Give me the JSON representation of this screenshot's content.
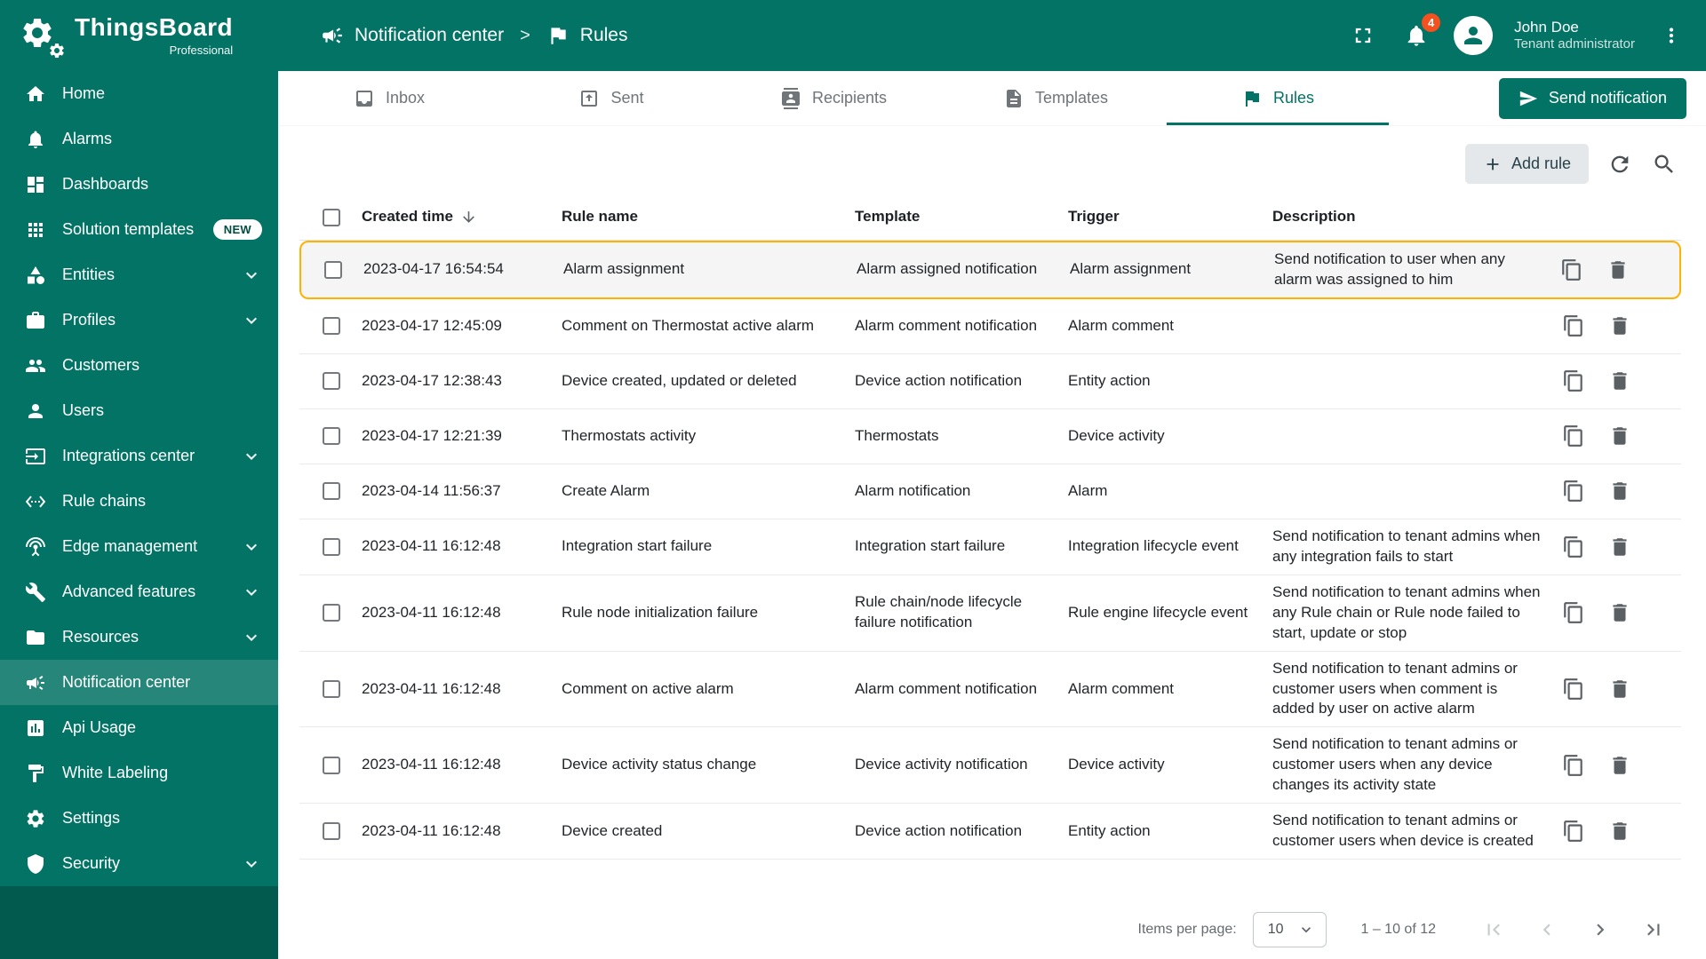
{
  "colors": {
    "primary": "#037365",
    "sidebar_bottom": "#025a4e",
    "highlight_border": "#ffb300",
    "notification_badge_bg": "#f4511e"
  },
  "brand": {
    "name": "ThingsBoard",
    "edition": "Professional"
  },
  "header": {
    "breadcrumb": [
      {
        "label": "Notification center",
        "icon": "campaign"
      },
      {
        "label": "Rules",
        "icon": "flag"
      }
    ],
    "separator": ">",
    "notifications_badge": "4",
    "user": {
      "name": "John Doe",
      "role": "Tenant administrator"
    }
  },
  "sidebar": {
    "items": [
      {
        "label": "Home",
        "icon": "home"
      },
      {
        "label": "Alarms",
        "icon": "bell"
      },
      {
        "label": "Dashboards",
        "icon": "dashboard"
      },
      {
        "label": "Solution templates",
        "icon": "apps",
        "badge": "NEW"
      },
      {
        "label": "Entities",
        "icon": "category",
        "expandable": true
      },
      {
        "label": "Profiles",
        "icon": "briefcase",
        "expandable": true
      },
      {
        "label": "Customers",
        "icon": "people"
      },
      {
        "label": "Users",
        "icon": "person"
      },
      {
        "label": "Integrations center",
        "icon": "input",
        "expandable": true
      },
      {
        "label": "Rule chains",
        "icon": "ethernet"
      },
      {
        "label": "Edge management",
        "icon": "antenna",
        "expandable": true
      },
      {
        "label": "Advanced features",
        "icon": "build",
        "expandable": true
      },
      {
        "label": "Resources",
        "icon": "folder",
        "expandable": true
      },
      {
        "label": "Notification center",
        "icon": "campaign",
        "active": true
      },
      {
        "label": "Api Usage",
        "icon": "chart"
      },
      {
        "label": "White Labeling",
        "icon": "paint"
      },
      {
        "label": "Settings",
        "icon": "gear"
      },
      {
        "label": "Security",
        "icon": "shield",
        "expandable": true
      }
    ]
  },
  "tabs": {
    "items": [
      {
        "label": "Inbox",
        "icon": "inbox"
      },
      {
        "label": "Sent",
        "icon": "outbox"
      },
      {
        "label": "Recipients",
        "icon": "contacts"
      },
      {
        "label": "Templates",
        "icon": "template"
      },
      {
        "label": "Rules",
        "icon": "flag",
        "active": true
      }
    ],
    "send_button": {
      "label": "Send notification",
      "icon": "send"
    }
  },
  "toolbar": {
    "add_rule_label": "Add rule"
  },
  "table": {
    "columns": [
      {
        "label": "Created time",
        "sortable": true,
        "sort": "desc"
      },
      {
        "label": "Rule name"
      },
      {
        "label": "Template"
      },
      {
        "label": "Trigger"
      },
      {
        "label": "Description"
      }
    ],
    "rows": [
      {
        "created": "2023-04-17 16:54:54",
        "name": "Alarm assignment",
        "template": "Alarm assigned notification",
        "trigger": "Alarm assignment",
        "description": "Send notification to user when any alarm was assigned to him",
        "highlighted": true
      },
      {
        "created": "2023-04-17 12:45:09",
        "name": "Comment on Thermostat active alarm",
        "template": "Alarm comment notification",
        "trigger": "Alarm comment",
        "description": ""
      },
      {
        "created": "2023-04-17 12:38:43",
        "name": "Device created, updated or deleted",
        "template": "Device action notification",
        "trigger": "Entity action",
        "description": ""
      },
      {
        "created": "2023-04-17 12:21:39",
        "name": "Thermostats activity",
        "template": "Thermostats",
        "trigger": "Device activity",
        "description": ""
      },
      {
        "created": "2023-04-14 11:56:37",
        "name": "Create Alarm",
        "template": "Alarm notification",
        "trigger": "Alarm",
        "description": ""
      },
      {
        "created": "2023-04-11 16:12:48",
        "name": "Integration start failure",
        "template": "Integration start failure",
        "trigger": "Integration lifecycle event",
        "description": "Send notification to tenant admins when any integration fails to start"
      },
      {
        "created": "2023-04-11 16:12:48",
        "name": "Rule node initialization failure",
        "template": "Rule chain/node lifecycle failure notification",
        "trigger": "Rule engine lifecycle event",
        "description": "Send notification to tenant admins when any Rule chain or Rule node failed to start, update or stop"
      },
      {
        "created": "2023-04-11 16:12:48",
        "name": "Comment on active alarm",
        "template": "Alarm comment notification",
        "trigger": "Alarm comment",
        "description": "Send notification to tenant admins or customer users when comment is added by user on active alarm"
      },
      {
        "created": "2023-04-11 16:12:48",
        "name": "Device activity status change",
        "template": "Device activity notification",
        "trigger": "Device activity",
        "description": "Send notification to tenant admins or customer users when any device changes its activity state"
      },
      {
        "created": "2023-04-11 16:12:48",
        "name": "Device created",
        "template": "Device action notification",
        "trigger": "Entity action",
        "description": "Send notification to tenant admins or customer users when device is created"
      }
    ]
  },
  "paginator": {
    "items_per_page_label": "Items per page:",
    "items_per_page_value": "10",
    "range_label": "1 – 10 of 12"
  }
}
